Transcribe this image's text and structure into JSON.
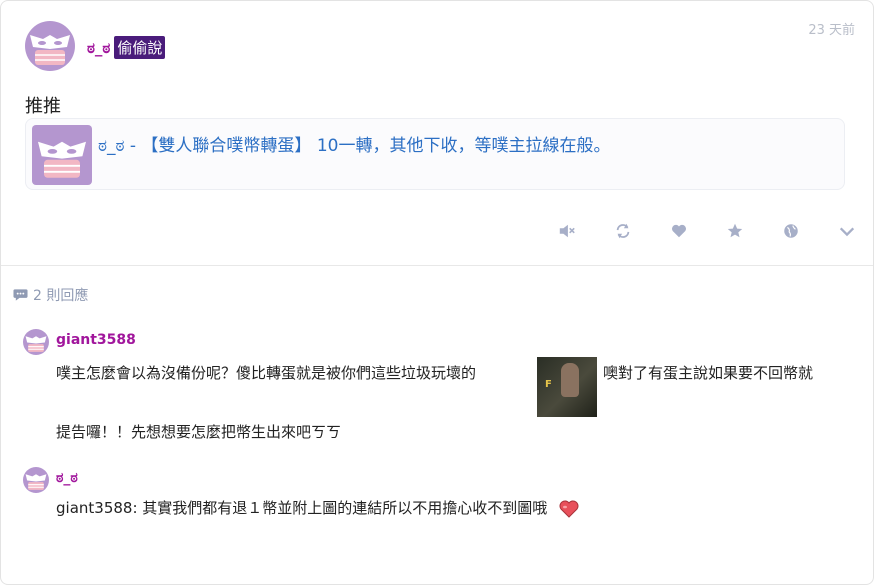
{
  "post": {
    "author_name": "ಠ_ಠ",
    "qualifier": "偷偷說",
    "time": "23 天前",
    "content": "推推",
    "quote": {
      "text": "ಠ_ಠ - 【雙人聯合噗幣轉蛋】 10一轉，其他下收，等噗主拉線在般。"
    },
    "actions": [
      {
        "name": "mute",
        "icon": "mute-icon"
      },
      {
        "name": "replurk",
        "icon": "replurk-icon"
      },
      {
        "name": "like",
        "icon": "heart-icon"
      },
      {
        "name": "favorite",
        "icon": "star-icon"
      },
      {
        "name": "share",
        "icon": "globe-icon"
      },
      {
        "name": "more",
        "icon": "chevron-down-icon"
      }
    ]
  },
  "responses_header": {
    "count_label": "2 則回應"
  },
  "responses": [
    {
      "author": "giant3588",
      "line1_before": "噗主怎麼會以為沒備份呢？傻比轉蛋就是被你們這些垃圾玩壞的",
      "line1_after": "噢對了有蛋主說如果要不回幣就",
      "line2": "提告囉！！先想想要怎麼把幣生出來吧ㄎㄎ",
      "image_label": "F"
    },
    {
      "author": "ಠ_ಠ",
      "text": "giant3588: 其實我們都有退１幣並附上圖的連結所以不用擔心收不到圖哦"
    }
  ],
  "colors": {
    "author": "#a1169c",
    "qualifier_bg": "#4a1c7b",
    "quote_link": "#2c6fc4",
    "action_icon": "#a7afc8",
    "meta": "#8f9ab3"
  }
}
